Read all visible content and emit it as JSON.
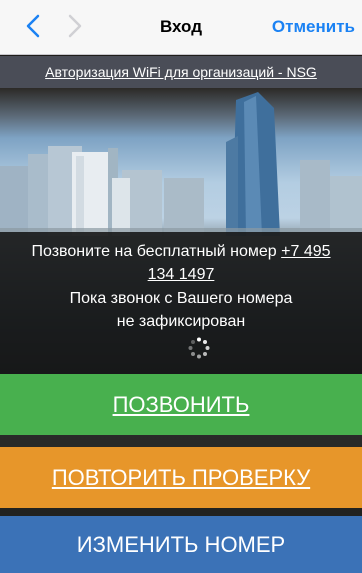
{
  "navbar": {
    "title": "Вход",
    "cancel_label": "Отменить",
    "back_icon": "chevron-left-icon",
    "forward_icon": "chevron-right-icon"
  },
  "header": {
    "org_link": "Авторизация WiFi для организаций - NSG"
  },
  "info": {
    "call_prompt": "Позвоните на бесплатный номер ",
    "phone_part1": "+7 495",
    "phone_part2": "134 1497",
    "status_line1": "Пока звонок с Вашего номера",
    "status_line2": "не зафиксирован"
  },
  "buttons": {
    "call": "ПОЗВОНИТЬ",
    "retry": "ПОВТОРИТЬ ПРОВЕРКУ",
    "change": "ИЗМЕНИТЬ НОМЕР"
  },
  "colors": {
    "accent": "#1b82f3",
    "call": "#48b04e",
    "retry": "#e7962a",
    "change": "#3b72b7"
  }
}
